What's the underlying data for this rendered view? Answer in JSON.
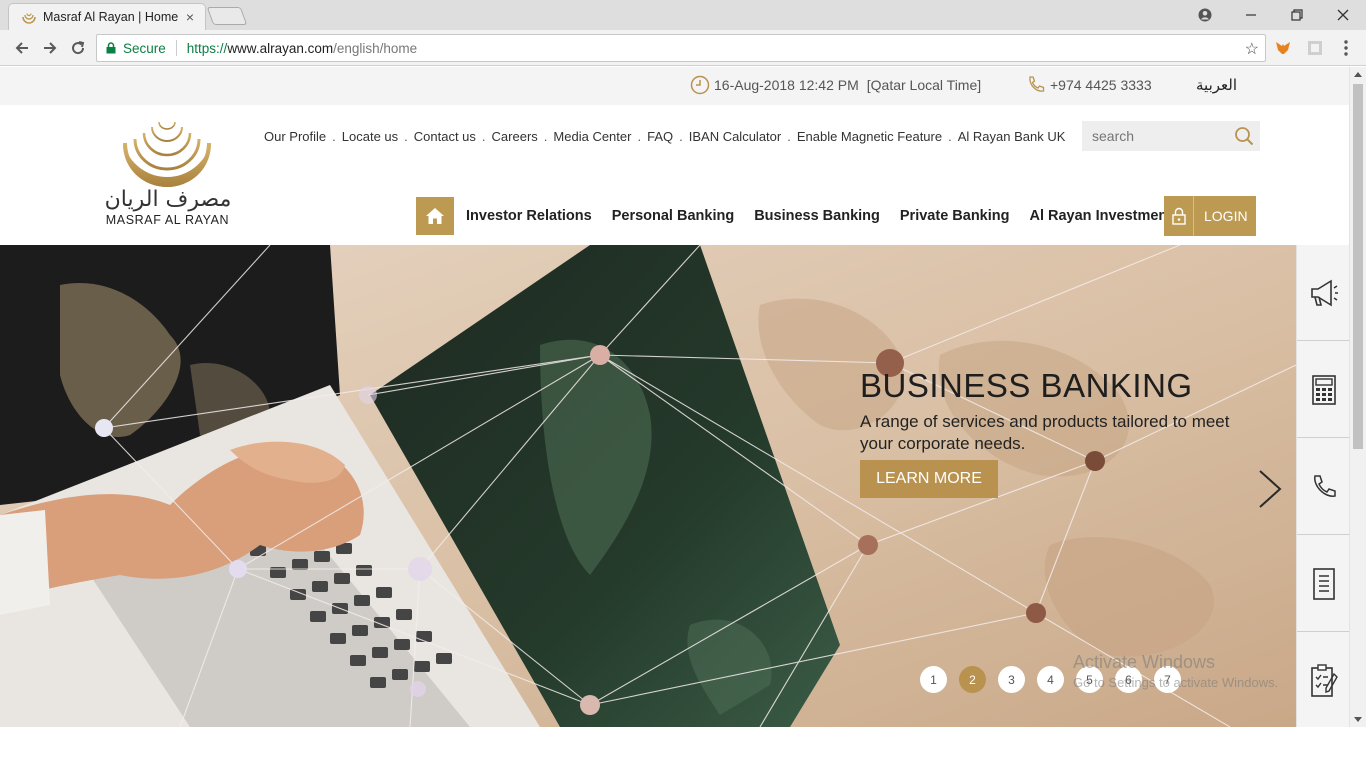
{
  "browser": {
    "tab_title": "Masraf Al Rayan | Home",
    "tab_close": "×",
    "address": {
      "secure_label": "Secure",
      "scheme": "https://",
      "host": "www.alrayan.com",
      "path": "/english/home"
    },
    "bookmark_star": "☆"
  },
  "topbar": {
    "datetime": "16-Aug-2018 12:42 PM",
    "timezone": "[Qatar Local Time]",
    "phone": "+974 4425 3333",
    "language": "العربية"
  },
  "logo": {
    "arabic_name": "مصرف الريان",
    "english_name": "MASRAF AL RAYAN"
  },
  "util_links": [
    "Our Profile",
    "Locate us",
    "Contact us",
    "Careers",
    "Media Center",
    "FAQ",
    "IBAN Calculator",
    "Enable Magnetic Feature",
    "Al Rayan Bank UK"
  ],
  "util_separator": ".",
  "search": {
    "placeholder": "search"
  },
  "main_nav": [
    "Investor Relations",
    "Personal Banking",
    "Business Banking",
    "Private Banking",
    "Al Rayan Investment"
  ],
  "login_label": "LOGIN",
  "hero": {
    "heading": "BUSINESS BANKING",
    "text": "A range of services and products tailored to meet your corporate needs.",
    "button": "LEARN MORE",
    "slides": [
      "1",
      "2",
      "3",
      "4",
      "5",
      "6",
      "7"
    ],
    "active_slide": 2
  },
  "watermark": {
    "line1": "Activate Windows",
    "line2": "Go to Settings to activate Windows."
  },
  "sidebar_icons": [
    "megaphone-icon",
    "calculator-icon",
    "phone-icon",
    "document-icon",
    "form-icon"
  ],
  "colors": {
    "gold": "#bd9a52",
    "hero_bg": "#d8c0a7"
  }
}
